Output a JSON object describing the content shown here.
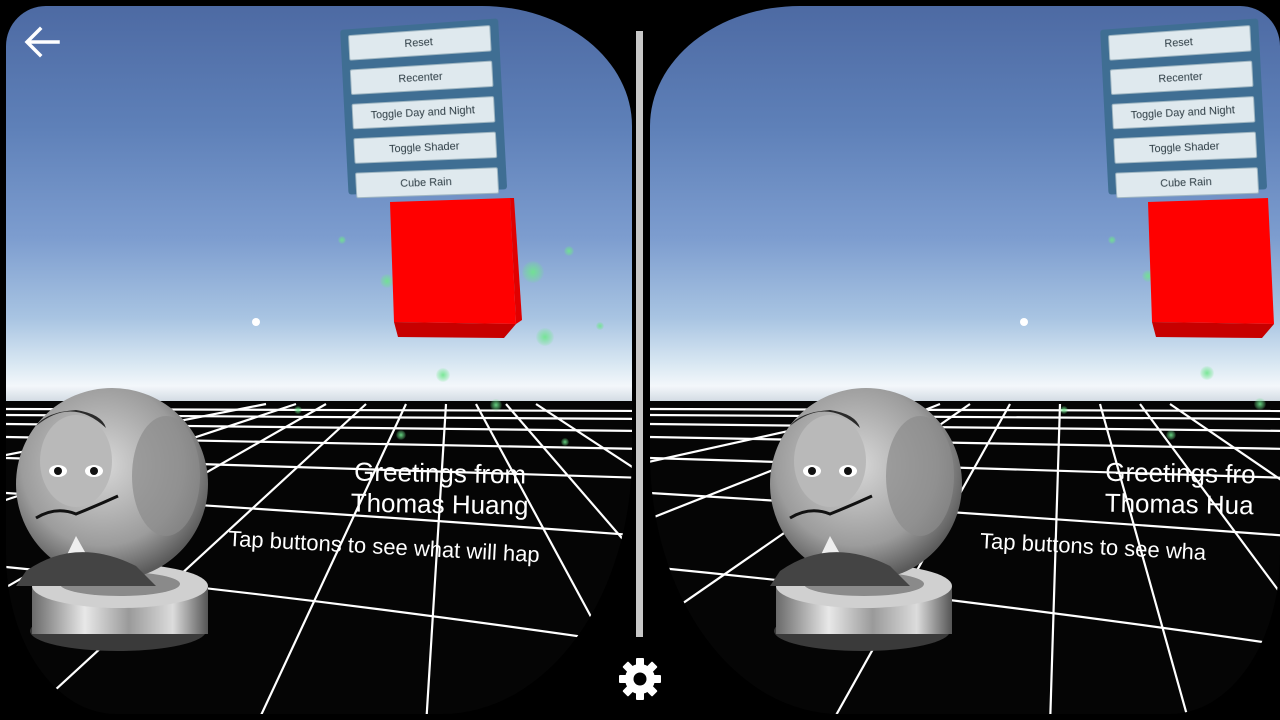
{
  "menu": {
    "buttons": [
      "Reset",
      "Recenter",
      "Toggle Day and Night",
      "Toggle Shader",
      "Cube Rain"
    ]
  },
  "scene": {
    "greeting_line1": "Greetings from",
    "greeting_line2": "Thomas Huang",
    "left_tap_text": "Tap buttons to see what will hap",
    "right_greeting_line1": "Greetings fro",
    "right_greeting_line2": "Thomas Hua",
    "right_tap_text": "Tap buttons to see wha"
  },
  "controls": {
    "back_icon": "arrow-left-icon",
    "settings_icon": "gear-icon"
  },
  "colors": {
    "cube": "#ff0000",
    "menu_panel": "#3f6e93",
    "menu_button": "#dfe9ee",
    "divider": "#c7c7c7"
  }
}
